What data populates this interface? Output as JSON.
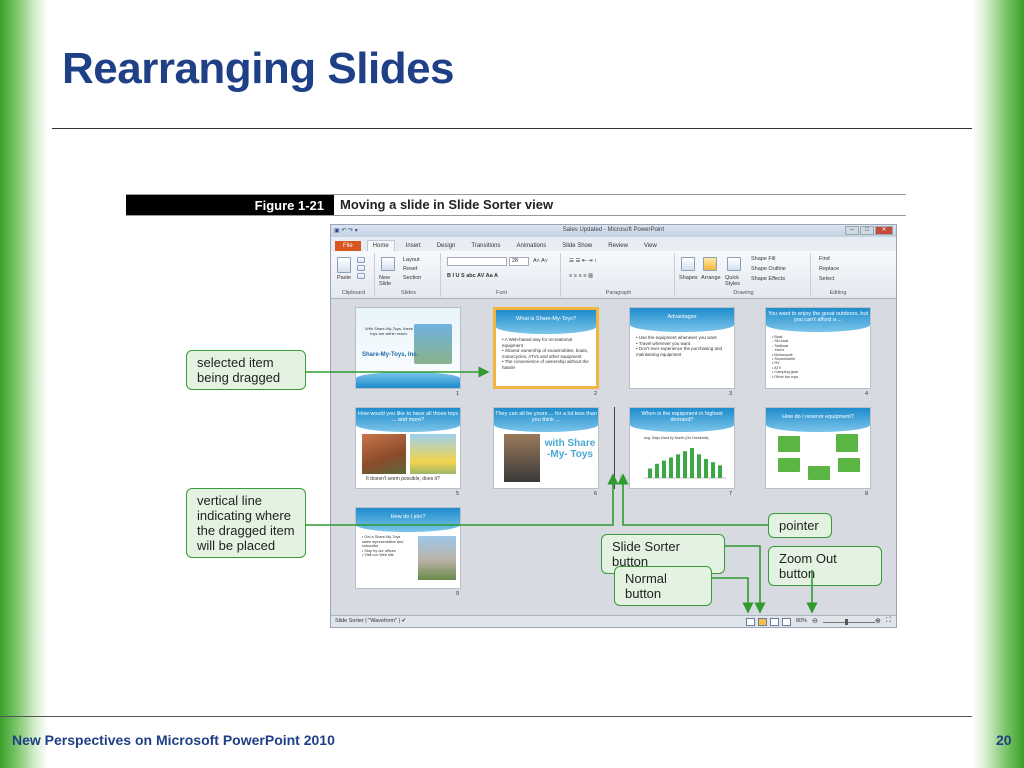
{
  "slide": {
    "title": "Rearranging Slides",
    "footer": "New Perspectives on Microsoft PowerPoint 2010",
    "page_number": "20"
  },
  "figure": {
    "label": "Figure 1-21",
    "description": "Moving a slide in Slide Sorter view"
  },
  "app": {
    "window_title": "Sales Updated - Microsoft PowerPoint",
    "tabs": [
      "File",
      "Home",
      "Insert",
      "Design",
      "Transitions",
      "Animations",
      "Slide Show",
      "Review",
      "View"
    ],
    "active_tab": "Home",
    "groups": {
      "clipboard": "Clipboard",
      "slides": "Slides",
      "font": "Font",
      "paragraph": "Paragraph",
      "drawing": "Drawing",
      "editing": "Editing"
    },
    "ribbon": {
      "paste": "Paste",
      "new_slide": "New Slide",
      "layout": "Layout",
      "reset": "Reset",
      "section": "Section",
      "font_size": "28",
      "shapes": "Shapes",
      "arrange": "Arrange",
      "quick_styles": "Quick Styles",
      "shape_fill": "Shape Fill",
      "shape_outline": "Shape Outline",
      "shape_effects": "Shape Effects",
      "find": "Find",
      "replace": "Replace",
      "select": "Select"
    },
    "slides": [
      {
        "num": "1",
        "title": "",
        "subtitle": "Share-My-Toys, Inc.",
        "body": "With Share-My-Toys, these toys are within reach."
      },
      {
        "num": "2",
        "title": "What is Share-My-Toys?",
        "body": "• A Web-based way for recreational equipment\n• Shared ownership of snowmobiles, boats, motorcycles, ATVs and other equipment\n• The convenience of ownership without the hassle"
      },
      {
        "num": "3",
        "title": "Advantages",
        "body": "• Use the equipment whenever you want\n• Travel wherever you want\n• Don't ever experience the purchasing and maintaining equipment"
      },
      {
        "num": "4",
        "title": "You want to enjoy the great outdoors, but you can't afford a ...",
        "body": "• Boat\n  - Ski boat\n  - Sailboat\n  - Yacht\n• Motorcycle\n• Snowmobile\n• RV\n• ATV\n• Camping gear\n• Other fun toys"
      },
      {
        "num": "5",
        "title": "How would you like to have all those toys ... and more?",
        "body": "It doesn't seem possible, does it?"
      },
      {
        "num": "6",
        "title": "They can all be yours ... for a lot less than you think ...",
        "body": "with Share -My- Toys"
      },
      {
        "num": "7",
        "title": "When is the equipment in highest demand?",
        "body": "Avg. Days Used by Month (On Hundreds)"
      },
      {
        "num": "8",
        "title": "How do I reserve equipment?",
        "body": ""
      },
      {
        "num": "9",
        "title": "How do I join?",
        "body": "• Get a Share-My-Toys sales representative and subscribe\n• Stop by our offices\n• Visit our Web site"
      }
    ],
    "statusbar": {
      "view_name": "Slide Sorter",
      "theme": "\"Waveform\"",
      "zoom": "80%"
    },
    "chart_bars": [
      12,
      18,
      22,
      26,
      30,
      34,
      38,
      30,
      24,
      20,
      16
    ]
  },
  "callouts": {
    "selected": "selected item being dragged",
    "vertical_line": "vertical line indicating where the dragged item will be placed",
    "pointer": "pointer",
    "slide_sorter": "Slide Sorter button",
    "zoom_out": "Zoom Out button",
    "normal": "Normal button"
  }
}
